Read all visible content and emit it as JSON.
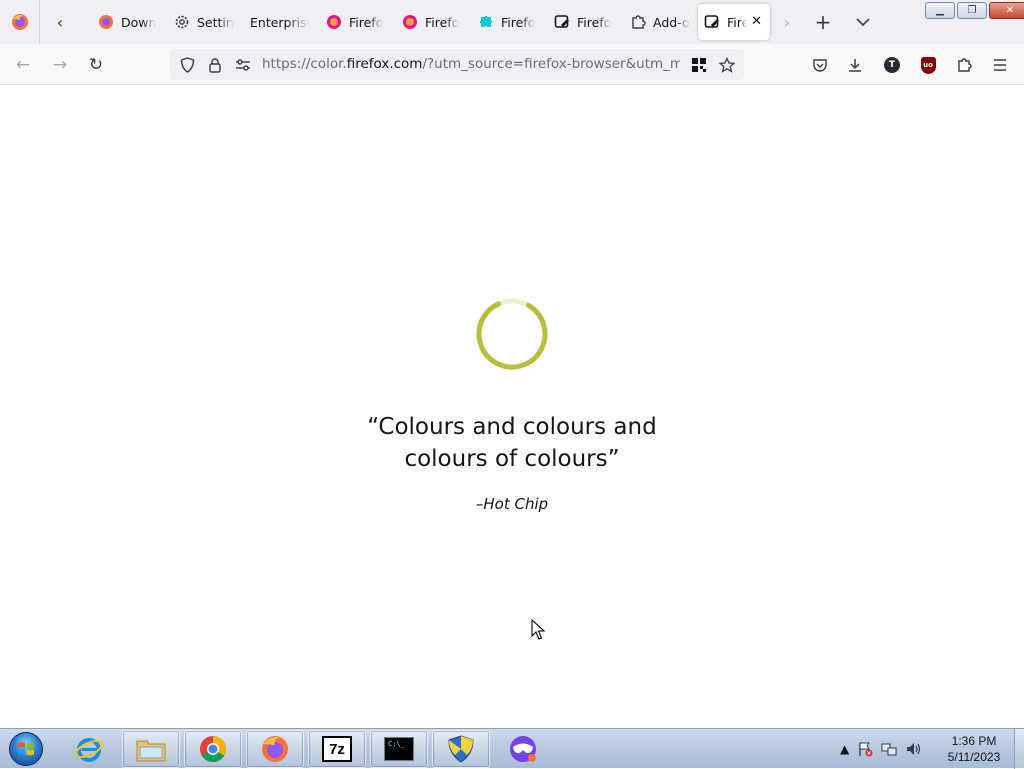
{
  "tabs": [
    {
      "label": "Down",
      "icon": "firefox-icon"
    },
    {
      "label": "Settin",
      "icon": "gear-icon"
    },
    {
      "label": "Enterprise",
      "icon": ""
    },
    {
      "label": "Firefo",
      "icon": "firefox-beta-icon"
    },
    {
      "label": "Firefo",
      "icon": "firefox-beta-icon"
    },
    {
      "label": "Firefo",
      "icon": "puzzle-colorful-icon"
    },
    {
      "label": "Firefo",
      "icon": "colorway-icon"
    },
    {
      "label": "Add-o",
      "icon": "puzzle-icon"
    },
    {
      "label": "Fire",
      "icon": "colorway-icon",
      "active": true
    }
  ],
  "url": {
    "prefix": "https://color.",
    "domain": "firefox.com",
    "rest": "/?utm_source=firefox-browser&utm_medium"
  },
  "content": {
    "quote_line1": "“Colours and colours and",
    "quote_line2": "colours of colours”",
    "author": "–Hot Chip",
    "spinner_color": "#b8bf3f",
    "spinner_track_color": "#eef0d6"
  },
  "avatar_letter": "T",
  "ublock_label": "uo",
  "terminal_label": "C:\\_",
  "sevenzip_label": "7z",
  "clock": {
    "time": "1:36 PM",
    "date": "5/11/2023"
  }
}
